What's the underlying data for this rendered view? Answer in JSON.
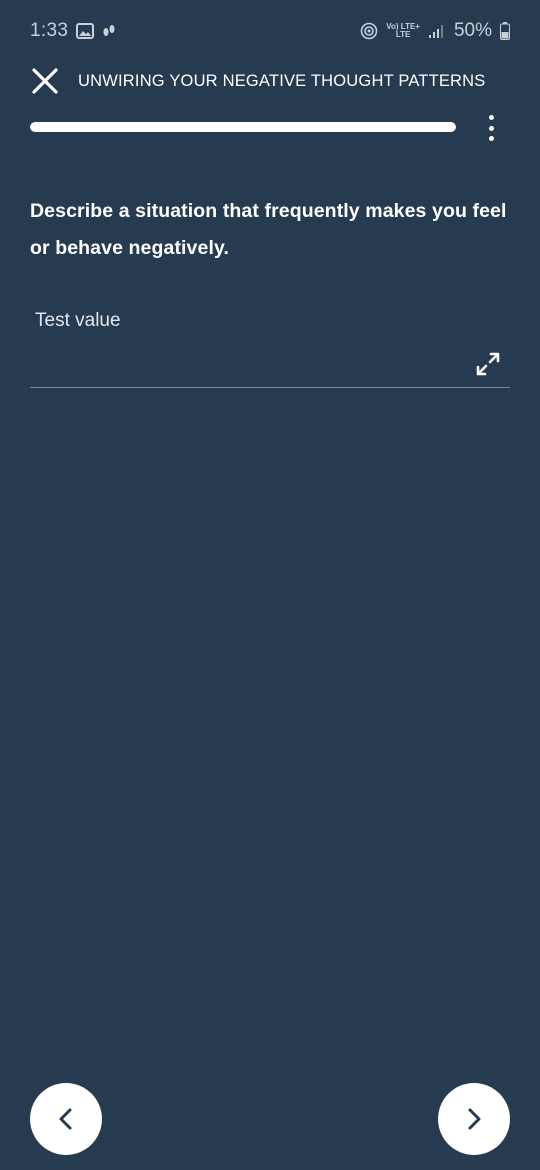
{
  "status_bar": {
    "time": "1:33",
    "lte_top": "Vo) LTE+",
    "lte_bottom": "LTE",
    "battery": "50%",
    "icons": [
      "gallery-icon",
      "step-counter-icon",
      "hotspot-icon",
      "volte-icon",
      "signal-icon",
      "battery-icon"
    ]
  },
  "header": {
    "title": "UNWIRING YOUR NEGATIVE THOUGHT PATTERNS",
    "close_icon": "close-icon"
  },
  "progress": {
    "fraction": 1.0,
    "menu_icon": "more-vertical-icon"
  },
  "question": {
    "text": "Describe a situation that frequently makes you feel or behave negatively."
  },
  "answer": {
    "value": "Test value",
    "expand_icon": "expand-icon"
  },
  "navigation": {
    "prev_icon": "chevron-left-icon",
    "next_icon": "chevron-right-icon"
  },
  "colors": {
    "background": "#263a50",
    "text": "#ffffff",
    "button_bg": "#ffffff",
    "icon_dark": "#263a50"
  }
}
